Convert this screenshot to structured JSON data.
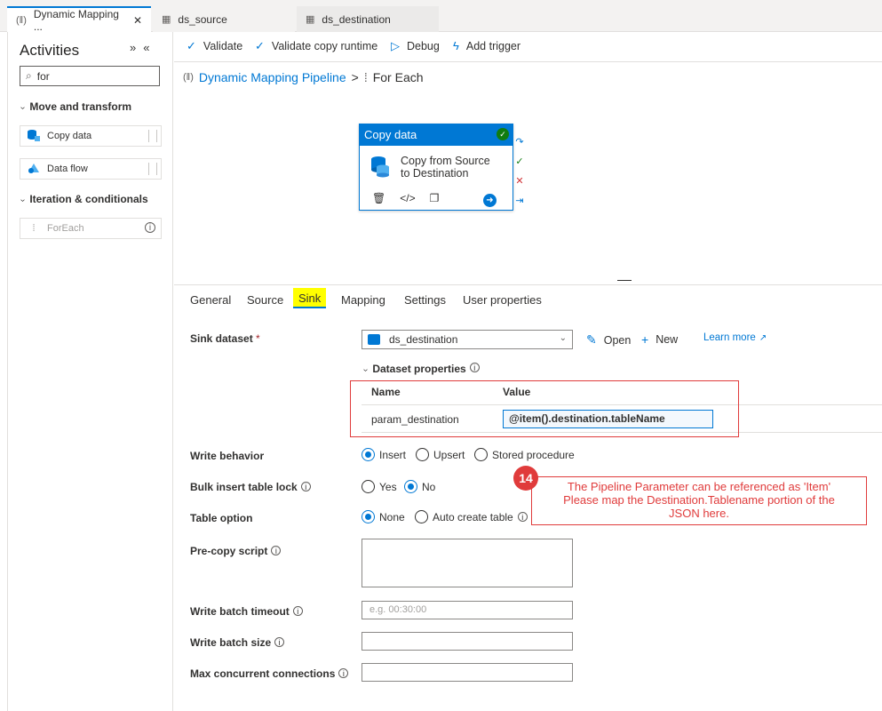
{
  "tabs": [
    {
      "label": "Dynamic Mapping ...",
      "icon": "pipeline-icon"
    },
    {
      "label": "ds_source",
      "icon": "table-icon"
    },
    {
      "label": "ds_destination",
      "icon": "table-icon"
    }
  ],
  "activities": {
    "title": "Activities",
    "search_value": "for",
    "sections": [
      "Move and transform",
      "Iteration & conditionals"
    ],
    "items": [
      "Copy data",
      "Data flow",
      "ForEach"
    ]
  },
  "toolbar": {
    "validate": "Validate",
    "validate_runtime": "Validate copy runtime",
    "debug": "Debug",
    "add_trigger": "Add trigger"
  },
  "breadcrumb": {
    "pipeline": "Dynamic Mapping Pipeline",
    "separator": ">",
    "current": "For Each"
  },
  "card": {
    "type": "Copy data",
    "description_line1": "Copy from Source",
    "description_line2": "to Destination"
  },
  "prop_tabs": [
    "General",
    "Source",
    "Sink",
    "Mapping",
    "Settings",
    "User properties"
  ],
  "sink": {
    "dataset_label": "Sink dataset",
    "required_mark": "*",
    "dataset_value": "ds_destination",
    "open": "Open",
    "new": "New",
    "learn_more": "Learn more",
    "dataset_props": "Dataset properties",
    "col_name": "Name",
    "col_value": "Value",
    "param_name": "param_destination",
    "param_value": "@item().destination.tableName",
    "write_behavior": "Write behavior",
    "wb_options": [
      "Insert",
      "Upsert",
      "Stored procedure"
    ],
    "bulk_lock": "Bulk insert table lock",
    "bulk_options": [
      "Yes",
      "No"
    ],
    "table_option": "Table option",
    "table_options": [
      "None",
      "Auto create table"
    ],
    "precopy": "Pre-copy script",
    "batch_timeout": "Write batch timeout",
    "batch_timeout_placeholder": "e.g. 00:30:00",
    "batch_size": "Write batch size",
    "max_conn": "Max concurrent connections"
  },
  "annotation": {
    "number": "14",
    "line1": "The Pipeline Parameter can be referenced as 'Item'",
    "line2": "Please map the Destination.Tablename portion of the",
    "line3": "JSON here."
  },
  "colors": {
    "accent": "#0078d4",
    "annotation": "#e03b3b",
    "highlight": "#ffff00",
    "success": "#107c10"
  }
}
